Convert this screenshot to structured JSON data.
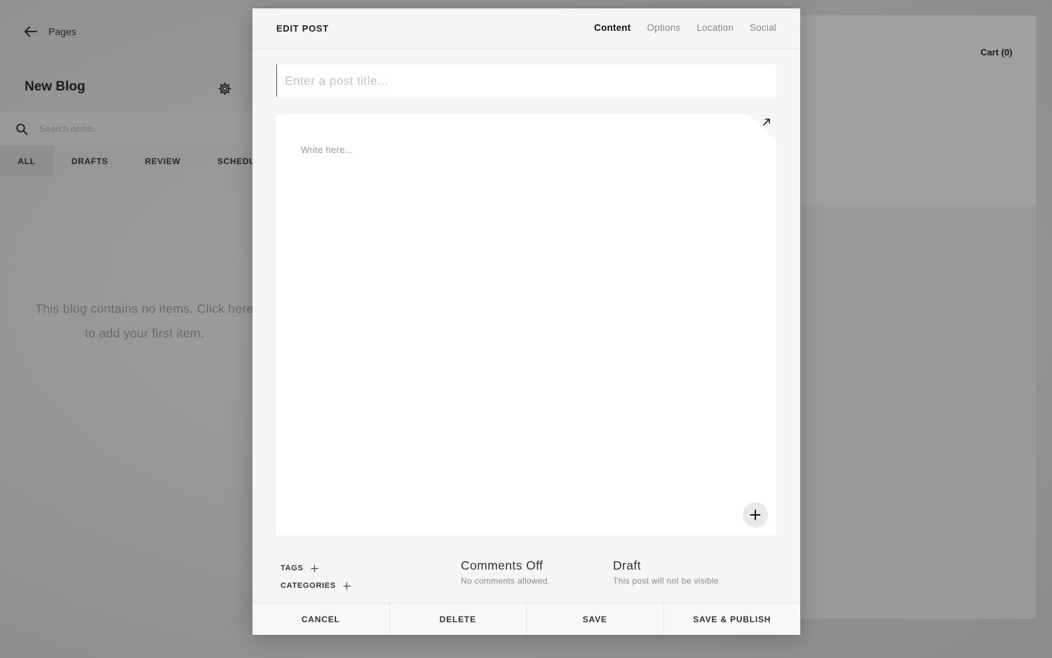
{
  "sidebar": {
    "back_label": "Pages",
    "blog_title": "New Blog",
    "search_placeholder": "Search items...",
    "filter_tabs": [
      {
        "label": "ALL",
        "active": true
      },
      {
        "label": "DRAFTS",
        "active": false
      },
      {
        "label": "REVIEW",
        "active": false
      },
      {
        "label": "SCHEDU",
        "active": false
      }
    ],
    "empty_message": "This blog contains no items. Click here to add your first item."
  },
  "preview": {
    "cart_label": "Cart (0)"
  },
  "modal": {
    "title": "EDIT POST",
    "tabs": [
      {
        "label": "Content",
        "active": true
      },
      {
        "label": "Options",
        "active": false
      },
      {
        "label": "Location",
        "active": false
      },
      {
        "label": "Social",
        "active": false
      }
    ],
    "post_title_placeholder": "Enter a post title...",
    "editor_placeholder": "Write here...",
    "tags_label": "TAGS",
    "categories_label": "CATEGORIES",
    "comments": {
      "title": "Comments Off",
      "subtitle": "No comments allowed."
    },
    "status": {
      "title": "Draft",
      "subtitle": "This post will not be visible."
    },
    "footer": {
      "cancel": "CANCEL",
      "delete": "DELETE",
      "save": "SAVE",
      "save_publish": "SAVE & PUBLISH"
    }
  },
  "icons": {
    "back": "arrow-left-icon",
    "settings": "gear-icon",
    "search": "search-icon",
    "expand": "expand-icon",
    "add": "plus-icon"
  },
  "colors": {
    "overlay": "#5a5a5a",
    "modal_bg": "#f5f5f5",
    "editor_bg": "#ffffff",
    "active_text": "#111111",
    "muted_text": "#888888"
  }
}
